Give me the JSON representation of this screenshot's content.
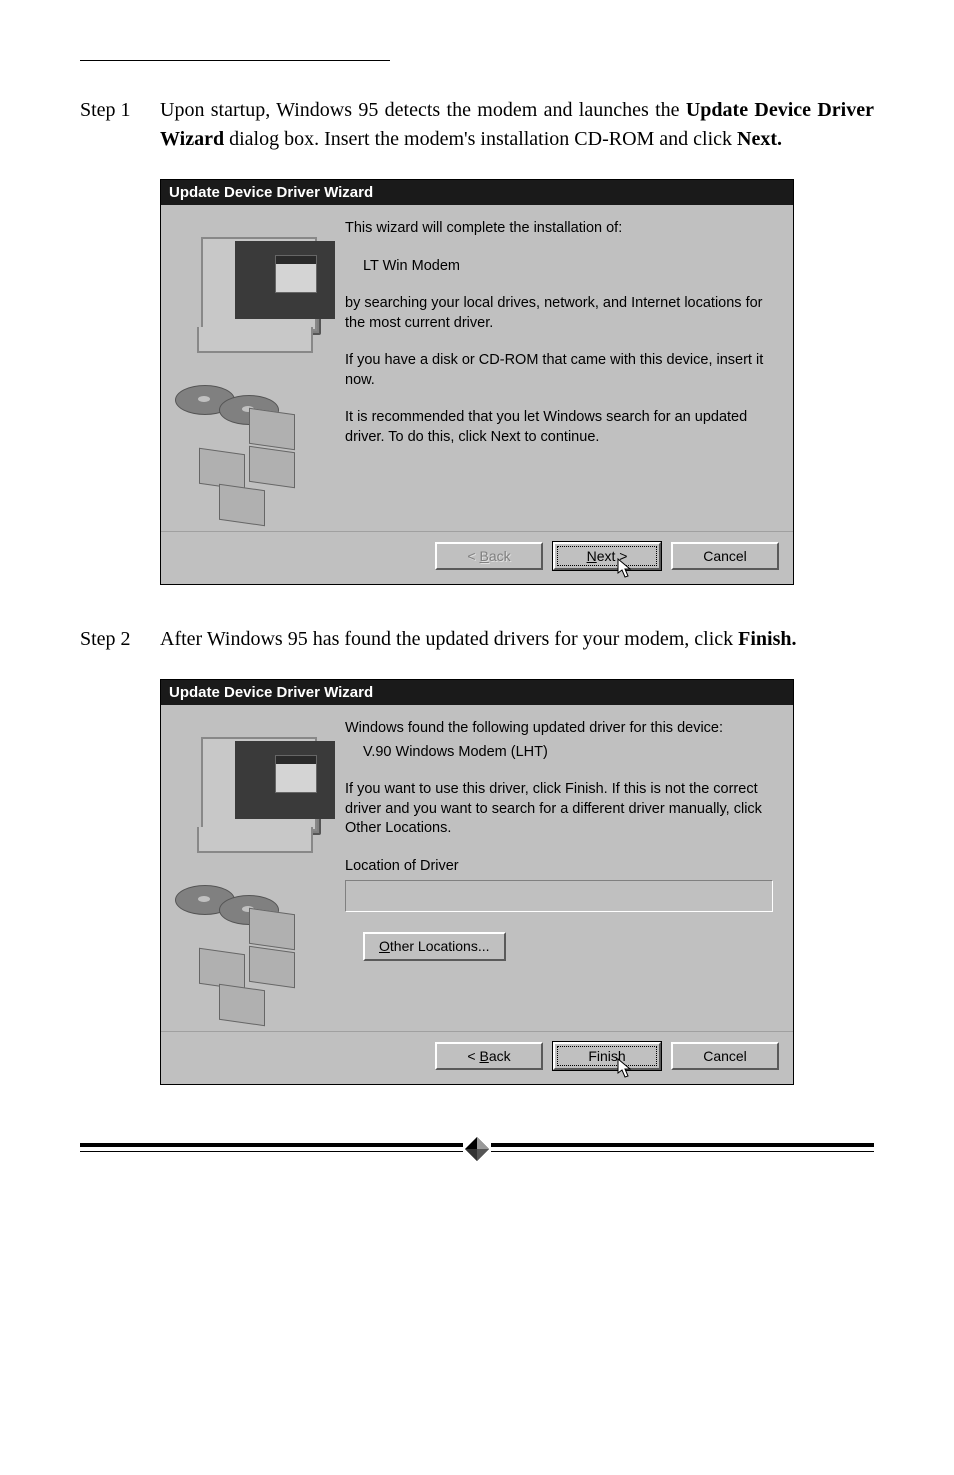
{
  "step1": {
    "label": "Step 1",
    "text_a": "Upon startup, Windows 95 detects the modem and launches the ",
    "bold1": "Update Device Driver Wizard",
    "text_b": " dialog box. Insert the modem's installation CD-ROM and click ",
    "bold2": "Next."
  },
  "dialog1": {
    "title": "Update Device Driver Wizard",
    "p1": "This wizard will complete the installation of:",
    "device": "LT Win Modem",
    "p2": "by searching your local drives, network, and Internet locations for the most current driver.",
    "p3": "If you have a disk or CD-ROM that came with this device, insert it now.",
    "p4": "It is recommended that you let Windows search for an updated driver. To do this, click Next to continue.",
    "back_pre": "< ",
    "back_u": "B",
    "back_post": "ack",
    "next_pre": "",
    "next_u": "N",
    "next_post": "ext >",
    "cancel": "Cancel"
  },
  "step2": {
    "label": "Step 2",
    "text_a": "After Windows 95 has found the updated drivers for your modem, click ",
    "bold1": "Finish."
  },
  "dialog2": {
    "title": "Update Device Driver Wizard",
    "p1": "Windows found the following updated driver for this device:",
    "device": "V.90 Windows Modem (LHT)",
    "p2": "If you want to use this driver, click Finish. If this is not the correct driver and you want to search for a different driver manually, click Other Locations.",
    "loc_label": "Location of Driver",
    "other_u": "O",
    "other_post": "ther Locations...",
    "back_pre": "< ",
    "back_u": "B",
    "back_post": "ack",
    "finish": "Finish",
    "cancel": "Cancel"
  }
}
